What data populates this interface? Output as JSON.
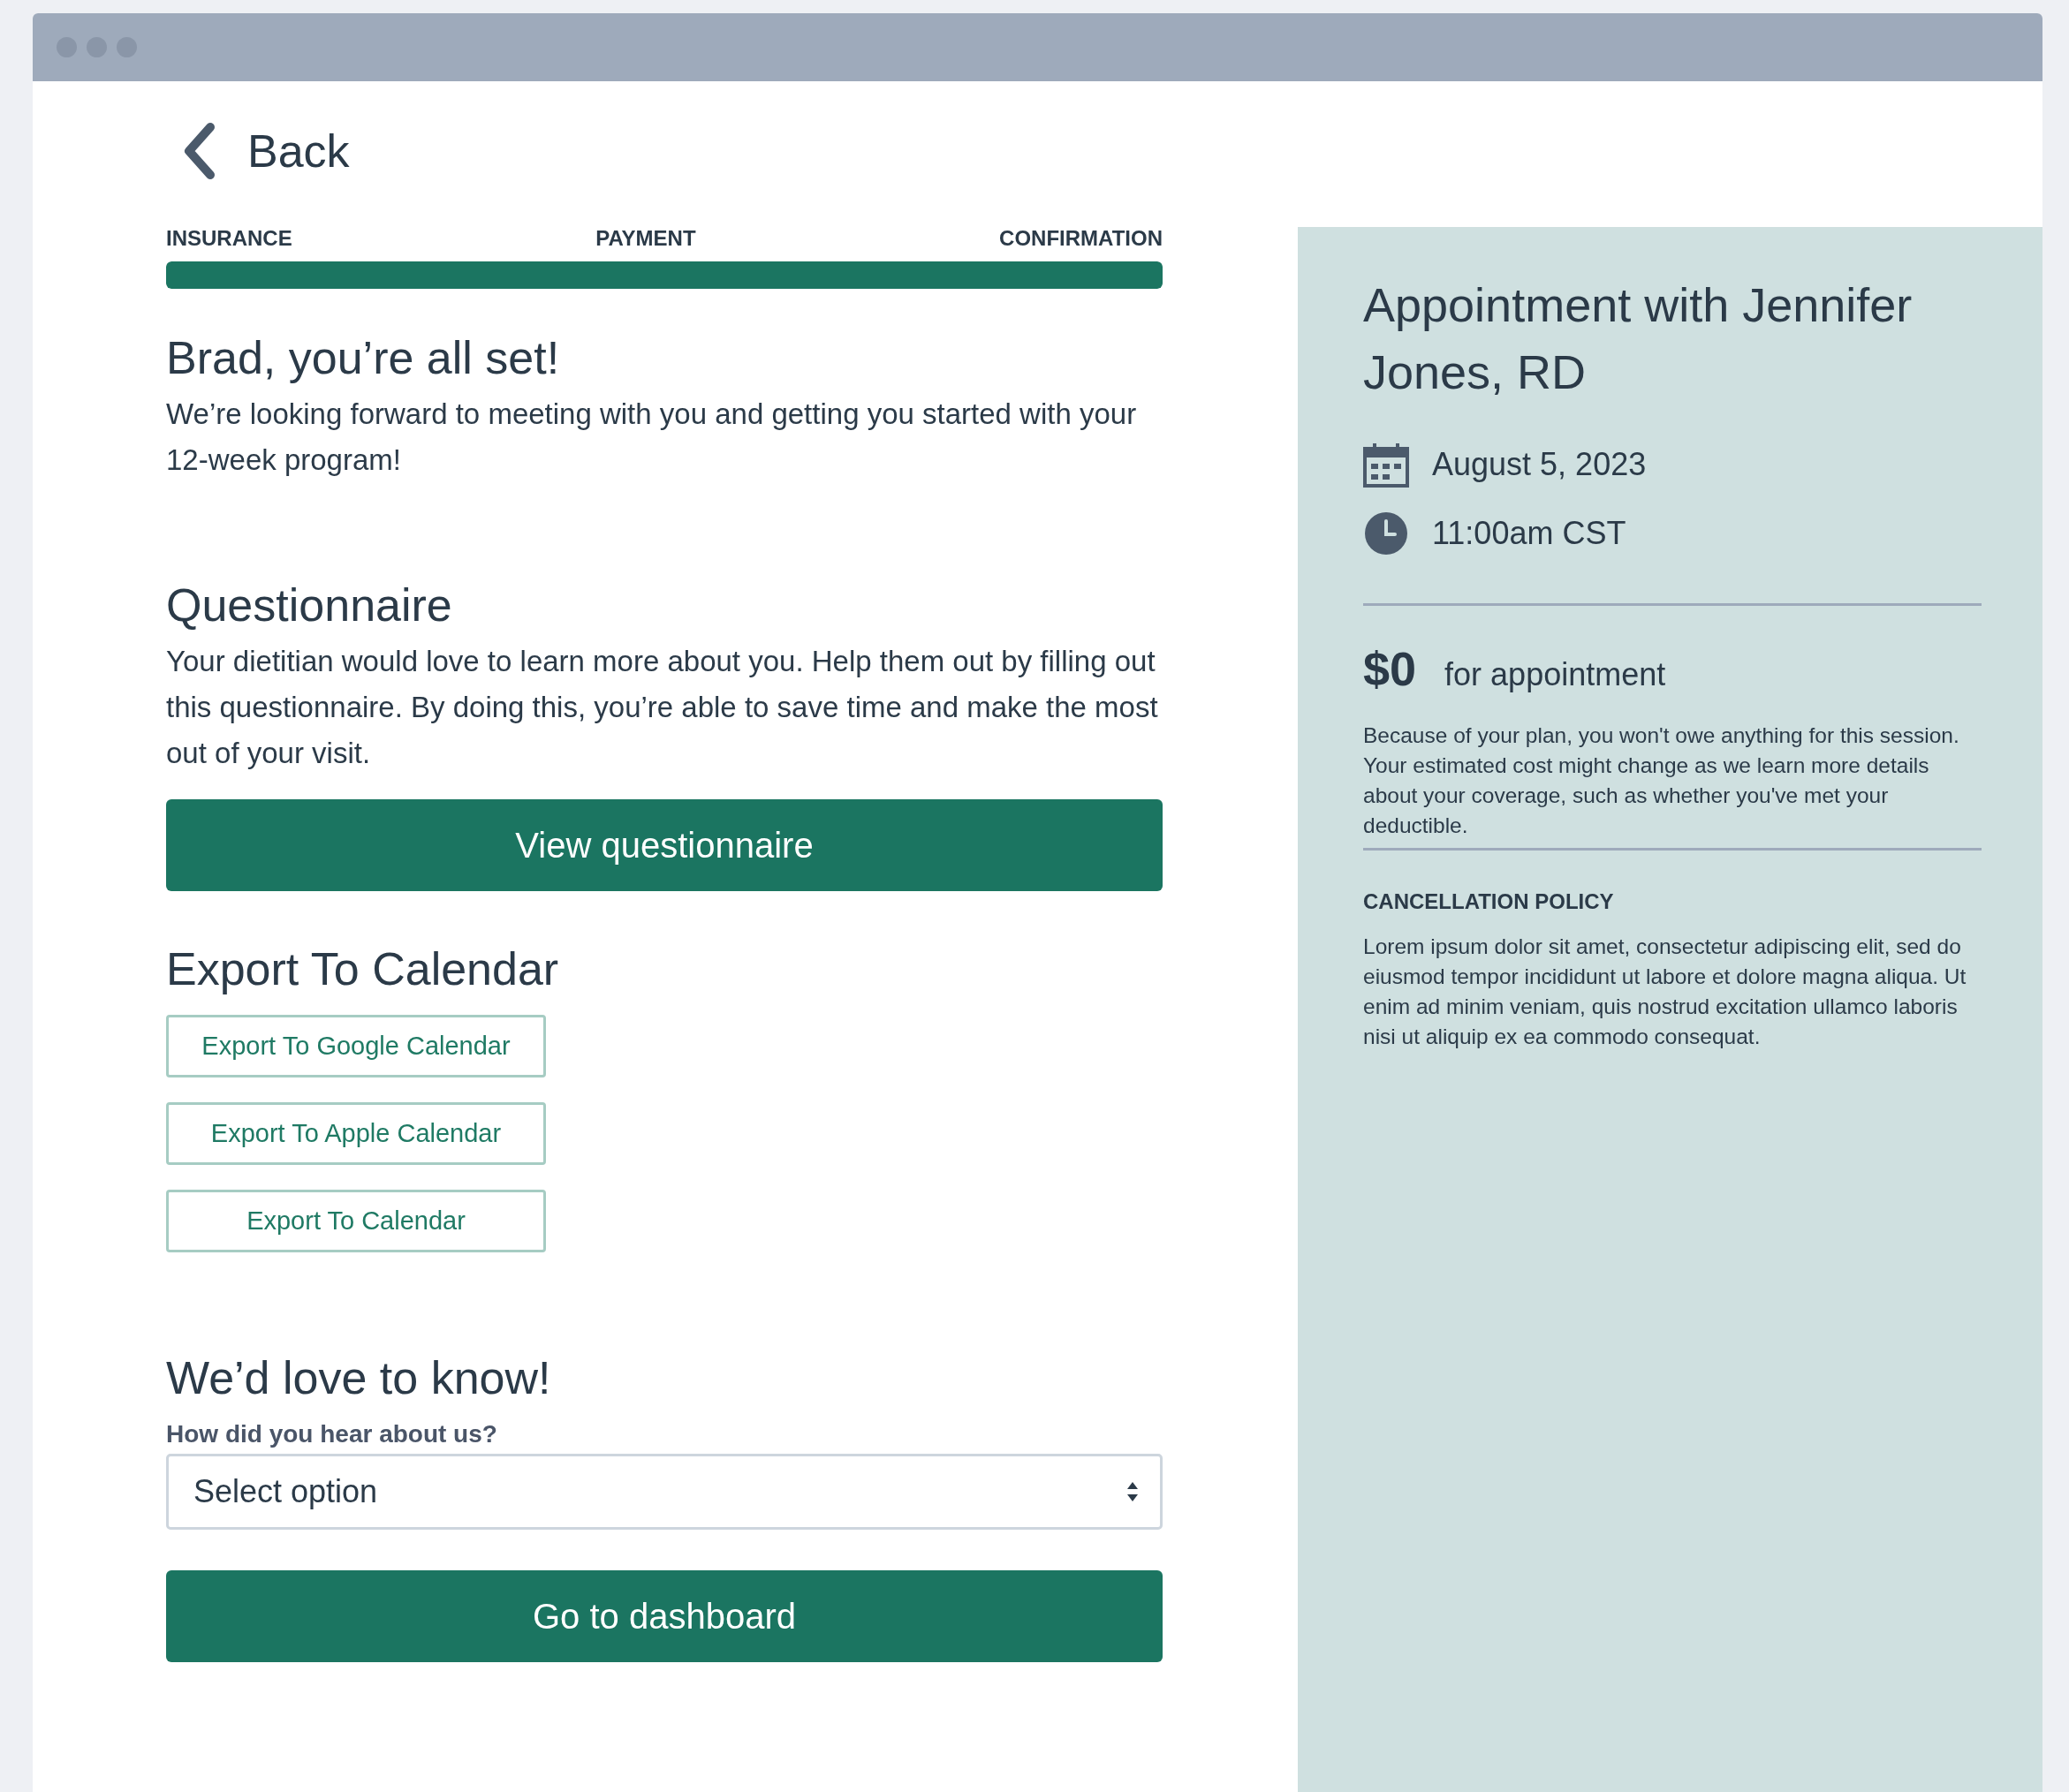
{
  "back": {
    "label": "Back"
  },
  "progress": {
    "steps": [
      "INSURANCE",
      "PAYMENT",
      "CONFIRMATION"
    ],
    "level": 1
  },
  "confirmation": {
    "title": "Brad, you’re all set!",
    "text": "We’re looking forward to meeting with you and getting you started with your 12-week program!"
  },
  "questionnaire": {
    "title": "Questionnaire",
    "text": "Your dietitian would love to learn more about you. Help them out by filling out this questionnaire. By doing this, you’re able to save time and make the most out of your visit.",
    "button": "View questionnaire"
  },
  "export": {
    "title": "Export To Calendar",
    "buttons": [
      "Export To Google Calendar",
      "Export To Apple Calendar",
      "Export To Calendar"
    ]
  },
  "survey": {
    "title": "We’d love to know!",
    "label": "How did you hear about us?",
    "placeholder": "Select option"
  },
  "dashboard_button": "Go to dashboard",
  "appointment": {
    "title": "Appointment with Jennifer Jones, RD",
    "date": "August 5, 2023",
    "time": "11:00am CST",
    "price": "$0",
    "price_note": "for appointment",
    "cost_text": "Because of your plan, you won't owe anything for this session. Your estimated cost might change as we learn more details about your coverage, such as whether you've met your deductible.",
    "policy_title": "CANCELLATION POLICY",
    "policy_text": "Lorem ipsum dolor sit amet, consectetur adipiscing elit, sed do eiusmod tempor incididunt ut labore et dolore magna aliqua. Ut enim ad minim veniam, quis nostrud excitation ullamco laboris nisi ut aliquip ex ea commodo consequat."
  }
}
